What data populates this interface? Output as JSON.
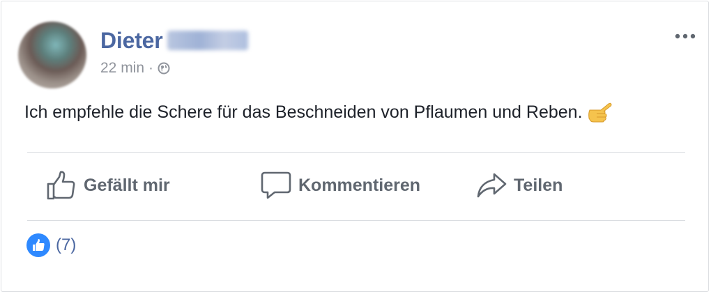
{
  "post": {
    "author_first_name": "Dieter",
    "time_ago": "22 min",
    "separator": "·",
    "audience_icon": "globe-icon",
    "more_icon": "more-options-icon",
    "text": "Ich empfehle die Schere für das Beschneiden von Pflaumen und Reben.",
    "emoji_icon": "thumbs-up-emoji-icon"
  },
  "actions": {
    "like_label": "Gefällt mir",
    "comment_label": "Kommentieren",
    "share_label": "Teilen"
  },
  "reactions": {
    "count_label": "(7)",
    "icon": "like-reaction-icon"
  },
  "colors": {
    "author": "#4b67a1",
    "action_text": "#606770",
    "like_blue": "#2e89ff",
    "meta_gray": "#90949c"
  }
}
